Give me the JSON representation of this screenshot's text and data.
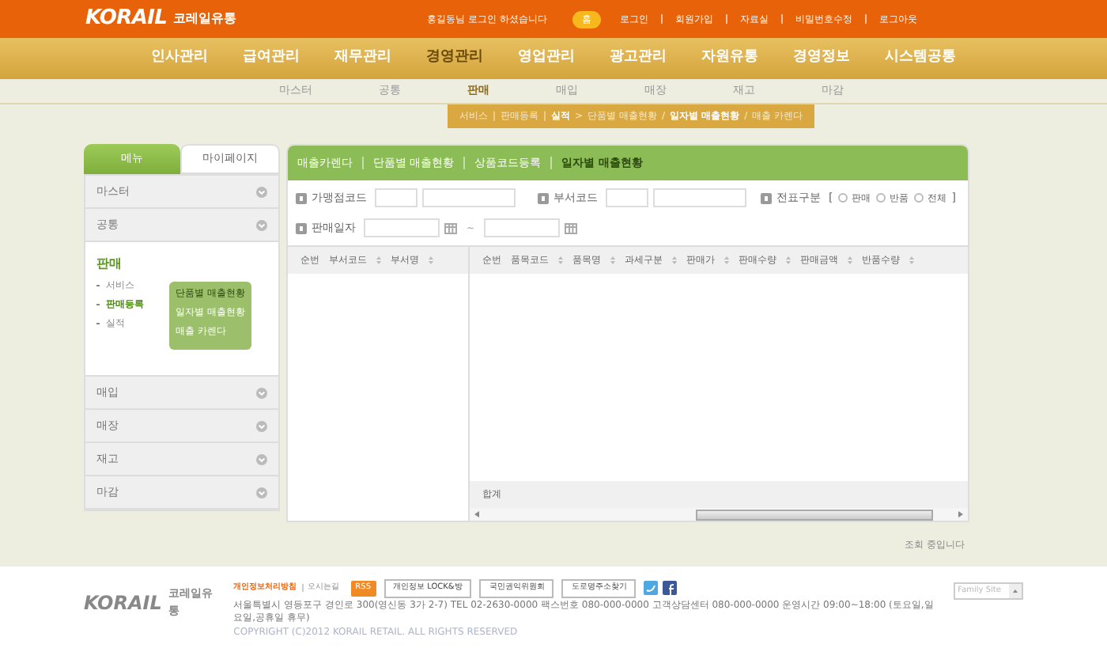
{
  "header": {
    "logo": "KORAIL",
    "logo_sub": "코레일유통",
    "greeting": "홍길동님 로그인 하셨습니다",
    "home": "홈",
    "links": [
      "로그인",
      "회원가입",
      "자료실",
      "비밀번호수정",
      "로그아웃"
    ]
  },
  "main_nav": [
    {
      "label": "인사관리",
      "selected": false
    },
    {
      "label": "급여관리",
      "selected": false
    },
    {
      "label": "재무관리",
      "selected": false
    },
    {
      "label": "경영관리",
      "selected": true
    },
    {
      "label": "영업관리",
      "selected": false
    },
    {
      "label": "광고관리",
      "selected": false
    },
    {
      "label": "자원유통",
      "selected": false
    },
    {
      "label": "경영정보",
      "selected": false
    },
    {
      "label": "시스템공통",
      "selected": false
    }
  ],
  "sub_nav": [
    {
      "label": "마스터",
      "selected": false
    },
    {
      "label": "공통",
      "selected": false
    },
    {
      "label": "판매",
      "selected": true
    },
    {
      "label": "매입",
      "selected": false
    },
    {
      "label": "매장",
      "selected": false
    },
    {
      "label": "재고",
      "selected": false
    },
    {
      "label": "마감",
      "selected": false
    }
  ],
  "breadcrumb": [
    {
      "label": "서비스",
      "selected": false,
      "sep": "|"
    },
    {
      "label": "판매등록",
      "selected": false,
      "sep": "|"
    },
    {
      "label": "실적",
      "selected": true,
      "sep": ">"
    },
    {
      "label": "단품별 매출현황",
      "selected": false,
      "sep": "/"
    },
    {
      "label": "일자별 매출현황",
      "selected": true,
      "sep": "/"
    },
    {
      "label": "매출 카렌다",
      "selected": false
    }
  ],
  "sidebar": {
    "tabs": [
      {
        "label": "메뉴",
        "selected": true
      },
      {
        "label": "마이페이지",
        "selected": false
      }
    ],
    "items": [
      {
        "label": "마스터",
        "expanded": false
      },
      {
        "label": "공통",
        "expanded": false
      },
      {
        "label": "판매",
        "expanded": true,
        "children": [
          {
            "label": "서비스",
            "selected": false
          },
          {
            "label": "판매등록",
            "selected": true
          },
          {
            "label": "실적",
            "selected": false
          }
        ],
        "popup": [
          "단품별 매출현황",
          "일자별 매출현황",
          "매출 카렌다"
        ]
      },
      {
        "label": "매입",
        "expanded": false
      },
      {
        "label": "매장",
        "expanded": false
      },
      {
        "label": "재고",
        "expanded": false
      },
      {
        "label": "마감",
        "expanded": false
      }
    ]
  },
  "content": {
    "tabs": [
      {
        "label": "매출카렌다",
        "selected": false
      },
      {
        "label": "단품별 매출현황",
        "selected": false
      },
      {
        "label": "상품코드등록",
        "selected": false
      },
      {
        "label": "일자별 매출현황",
        "selected": true
      }
    ],
    "filters": {
      "store_code": "가맹점코드",
      "dept_code": "부서코드",
      "slip_type": "전표구분",
      "slip_open": "[",
      "slip_close": "]",
      "slip_options": [
        {
          "label": "판매",
          "selected": false
        },
        {
          "label": "반품",
          "selected": false
        },
        {
          "label": "전체",
          "selected": false
        }
      ],
      "sale_date": "판매일자",
      "date_sep": "~"
    },
    "left_table": {
      "columns": [
        "순번",
        "부서코드",
        "부서명"
      ]
    },
    "right_table": {
      "columns": [
        "순번",
        "품목코드",
        "품목명",
        "과세구분",
        "판매가",
        "판매수량",
        "판매금액",
        "반품수량"
      ],
      "total_label": "합계"
    },
    "status": "조회 중입니다"
  },
  "footer": {
    "logo": "KORAIL",
    "logo_sub": "코레일유통",
    "links": [
      "개인정보처리방침",
      "오시는길"
    ],
    "rss": "RSS",
    "badges": [
      "개인정보 LOCK&방",
      "국민권익위원회",
      "도로명주소찾기"
    ],
    "address": "서울특별시 영등포구 경인로 300(영신동 3가 2-7) TEL 02-2630-0000 팩스번호 080-000-0000 고객상담센터 080-000-0000 운영시간 09:00~18:00 (토요일,일요일,공휴일 휴무)",
    "copyright": "COPYRIGHT (C)2012 KORAIL RETAIL. ALL RIGHTS RESERVED",
    "family_site": "Family Site"
  }
}
